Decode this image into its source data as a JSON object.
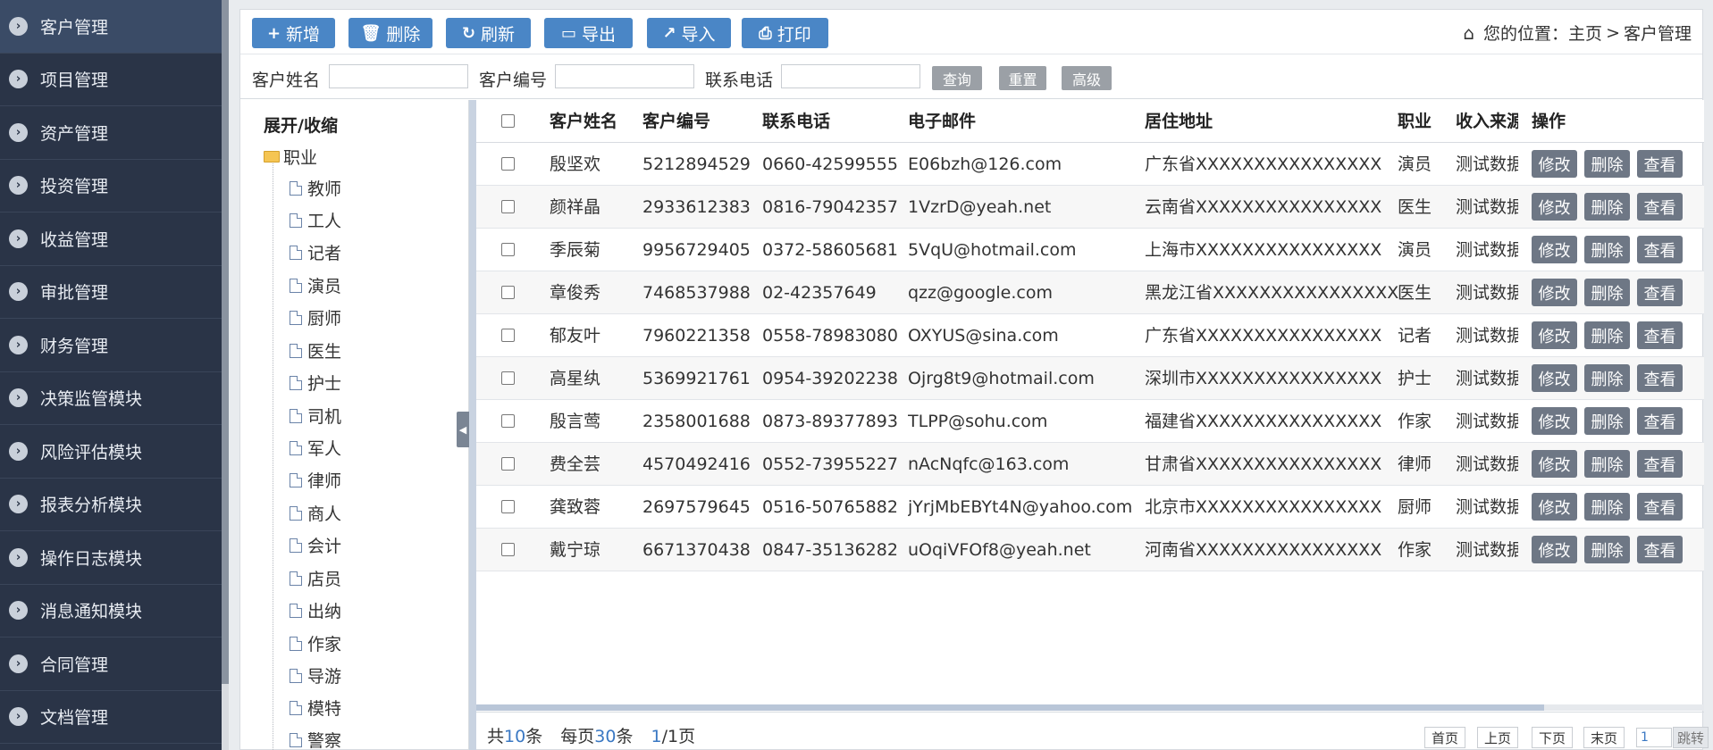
{
  "sidebar": {
    "items": [
      {
        "label": "客户管理"
      },
      {
        "label": "项目管理"
      },
      {
        "label": "资产管理"
      },
      {
        "label": "投资管理"
      },
      {
        "label": "收益管理"
      },
      {
        "label": "审批管理"
      },
      {
        "label": "财务管理"
      },
      {
        "label": "决策监管模块"
      },
      {
        "label": "风险评估模块"
      },
      {
        "label": "报表分析模块"
      },
      {
        "label": "操作日志模块"
      },
      {
        "label": "消息通知模块"
      },
      {
        "label": "合同管理"
      },
      {
        "label": "文档管理"
      }
    ]
  },
  "toolbar": {
    "add": "新增",
    "delete": "删除",
    "refresh": "刷新",
    "export": "导出",
    "import": "导入",
    "print": "打印"
  },
  "breadcrumb": {
    "prefix": "您的位置：",
    "home": "主页",
    "sep": ">",
    "current": "客户管理"
  },
  "search": {
    "name_label": "客户姓名",
    "code_label": "客户编号",
    "phone_label": "联系电话",
    "query": "查询",
    "reset": "重置",
    "advanced": "高级"
  },
  "tree": {
    "header": "展开/收缩",
    "root": "职业",
    "items": [
      "教师",
      "工人",
      "记者",
      "演员",
      "厨师",
      "医生",
      "护士",
      "司机",
      "军人",
      "律师",
      "商人",
      "会计",
      "店员",
      "出纳",
      "作家",
      "导游",
      "模特",
      "警察"
    ]
  },
  "table": {
    "columns": [
      "客户姓名",
      "客户编号",
      "联系电话",
      "电子邮件",
      "居住地址",
      "职业",
      "收入来源",
      "操作"
    ],
    "actions": {
      "edit": "修改",
      "delete": "删除",
      "view": "查看"
    },
    "rows": [
      {
        "name": "殷坚欢",
        "code": "5212894529",
        "phone": "0660-42599555",
        "email": "E06bzh@126.com",
        "address": "广东省XXXXXXXXXXXXXXXX",
        "job": "演员",
        "income": "测试数据"
      },
      {
        "name": "颜祥晶",
        "code": "2933612383",
        "phone": "0816-79042357",
        "email": "1VzrD@yeah.net",
        "address": "云南省XXXXXXXXXXXXXXXX",
        "job": "医生",
        "income": "测试数据"
      },
      {
        "name": "季辰菊",
        "code": "9956729405",
        "phone": "0372-58605681",
        "email": "5VqU@hotmail.com",
        "address": "上海市XXXXXXXXXXXXXXXX",
        "job": "演员",
        "income": "测试数据"
      },
      {
        "name": "章俊秀",
        "code": "7468537988",
        "phone": "02-42357649",
        "email": "qzz@google.com",
        "address": "黑龙江省XXXXXXXXXXXXXXXX",
        "job": "医生",
        "income": "测试数据"
      },
      {
        "name": "郁友叶",
        "code": "7960221358",
        "phone": "0558-78983080",
        "email": "OXYUS@sina.com",
        "address": "广东省XXXXXXXXXXXXXXXX",
        "job": "记者",
        "income": "测试数据"
      },
      {
        "name": "高星纨",
        "code": "5369921761",
        "phone": "0954-39202238",
        "email": "Ojrg8t9@hotmail.com",
        "address": "深圳市XXXXXXXXXXXXXXXX",
        "job": "护士",
        "income": "测试数据"
      },
      {
        "name": "殷言莺",
        "code": "2358001688",
        "phone": "0873-89377893",
        "email": "TLPP@sohu.com",
        "address": "福建省XXXXXXXXXXXXXXXX",
        "job": "作家",
        "income": "测试数据"
      },
      {
        "name": "费全芸",
        "code": "4570492416",
        "phone": "0552-73955227",
        "email": "nAcNqfc@163.com",
        "address": "甘肃省XXXXXXXXXXXXXXXX",
        "job": "律师",
        "income": "测试数据"
      },
      {
        "name": "龚致蓉",
        "code": "2697579645",
        "phone": "0516-50765882",
        "email": "jYrjMbEBYt4N@yahoo.com",
        "address": "北京市XXXXXXXXXXXXXXXX",
        "job": "厨师",
        "income": "测试数据"
      },
      {
        "name": "戴宁琼",
        "code": "6671370438",
        "phone": "0847-35136282",
        "email": "uOqiVFOf8@yeah.net",
        "address": "河南省XXXXXXXXXXXXXXXX",
        "job": "作家",
        "income": "测试数据"
      }
    ]
  },
  "pager": {
    "total_prefix": "共",
    "total": "10",
    "total_suffix": "条",
    "per_prefix": "每页",
    "per_page": "30",
    "per_suffix": "条",
    "current": "1",
    "pages_suffix": "/1页",
    "first": "首页",
    "prev": "上页",
    "next": "下页",
    "last": "末页",
    "jump_value": "1",
    "jump": "跳转"
  },
  "icons": {
    "sidebar": "chevron-circle-right-icon",
    "home": "home-icon",
    "tree_folder": "folder-icon",
    "tree_leaf": "document-icon"
  },
  "colors": {
    "sidebar_bg": "#2a3447",
    "primary_button": "#4a86c6",
    "action_button": "#6e7785",
    "link": "#3a78c3"
  }
}
